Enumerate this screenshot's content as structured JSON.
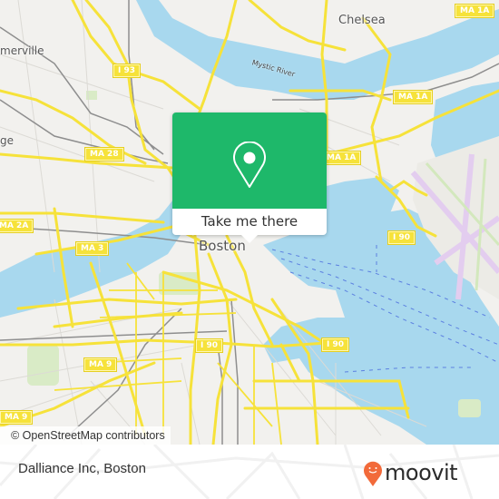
{
  "map": {
    "attribution": "© OpenStreetMap contributors",
    "colors": {
      "land": "#f2f1ee",
      "water": "#a8d8ee",
      "road": "#f6e23a",
      "park": "#d9ebc6",
      "airport": "#e9d6f2",
      "rail": "#888888"
    },
    "place_labels": [
      {
        "name": "chelsea",
        "text": "Chelsea"
      },
      {
        "name": "somerville",
        "text": "merville"
      },
      {
        "name": "cambridge",
        "text": "ge"
      },
      {
        "name": "boston",
        "text": "Boston"
      }
    ],
    "river_label": "Mystic River",
    "road_shields": [
      {
        "id": "i93",
        "text": "I 93"
      },
      {
        "id": "ma28",
        "text": "MA 28"
      },
      {
        "id": "ma2a",
        "text": "MA 2A"
      },
      {
        "id": "ma3",
        "text": "MA 3"
      },
      {
        "id": "ma1a-top",
        "text": "MA 1A"
      },
      {
        "id": "ma1a-mid",
        "text": "MA 1A"
      },
      {
        "id": "ma1a-low",
        "text": "MA 1A"
      },
      {
        "id": "i90-east",
        "text": "I 90"
      },
      {
        "id": "i90-center",
        "text": "I 90"
      },
      {
        "id": "i90-south",
        "text": "I 90"
      },
      {
        "id": "ma9-center",
        "text": "MA 9"
      },
      {
        "id": "ma9-west",
        "text": "MA 9"
      }
    ]
  },
  "popup": {
    "icon": "map-pin-icon",
    "button_label": "Take me there",
    "color": "#1eb86a"
  },
  "footer": {
    "place_name": "Dalliance Inc, Boston",
    "brand": "moovit",
    "brand_icon": "moovit-smiley-pin-icon",
    "brand_color": "#f26a3a"
  }
}
